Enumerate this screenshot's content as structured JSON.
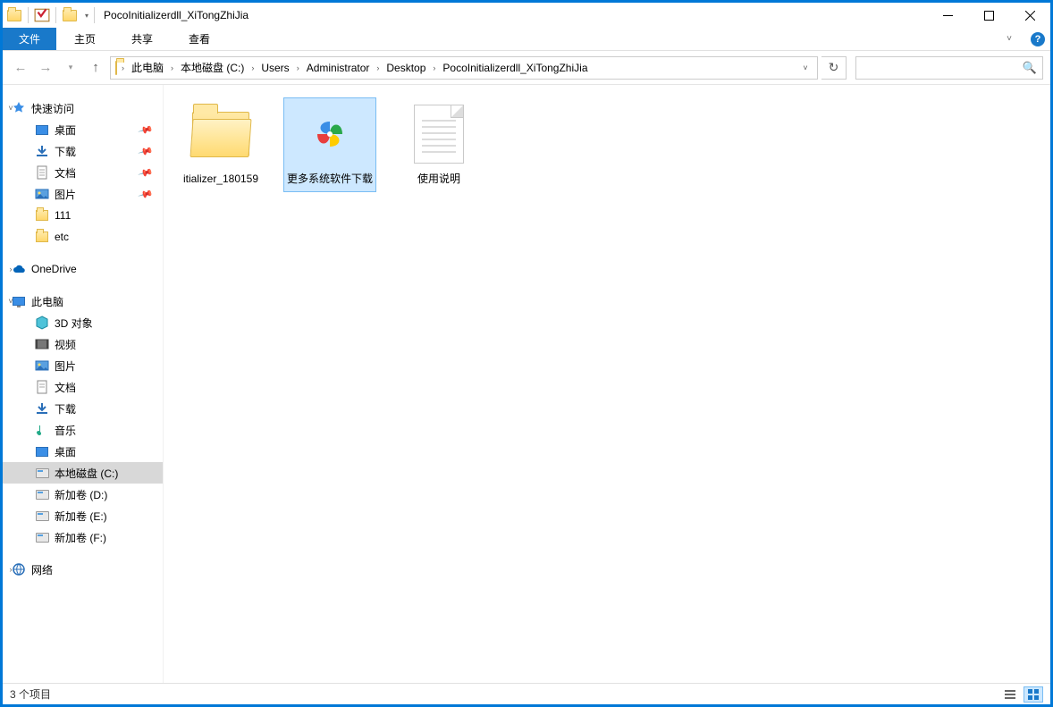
{
  "window": {
    "title": "PocoInitializerdll_XiTongZhiJia"
  },
  "ribbon": {
    "file": "文件",
    "tabs": [
      "主页",
      "共享",
      "查看"
    ]
  },
  "breadcrumb": {
    "items": [
      "此电脑",
      "本地磁盘 (C:)",
      "Users",
      "Administrator",
      "Desktop",
      "PocoInitializerdll_XiTongZhiJia"
    ]
  },
  "search": {
    "placeholder": ""
  },
  "tree": {
    "quick": {
      "label": "快速访问",
      "items": [
        {
          "label": "桌面",
          "pinned": true,
          "icon": "desktop"
        },
        {
          "label": "下载",
          "pinned": true,
          "icon": "download"
        },
        {
          "label": "文档",
          "pinned": true,
          "icon": "doc"
        },
        {
          "label": "图片",
          "pinned": true,
          "icon": "pic"
        },
        {
          "label": "111",
          "pinned": false,
          "icon": "folder"
        },
        {
          "label": "etc",
          "pinned": false,
          "icon": "folder"
        }
      ]
    },
    "onedrive": {
      "label": "OneDrive"
    },
    "pc": {
      "label": "此电脑",
      "items": [
        {
          "label": "3D 对象",
          "icon": "3d"
        },
        {
          "label": "视频",
          "icon": "video"
        },
        {
          "label": "图片",
          "icon": "pic"
        },
        {
          "label": "文档",
          "icon": "doc"
        },
        {
          "label": "下载",
          "icon": "download"
        },
        {
          "label": "音乐",
          "icon": "music"
        },
        {
          "label": "桌面",
          "icon": "desktop"
        },
        {
          "label": "本地磁盘 (C:)",
          "icon": "drive",
          "selected": true
        },
        {
          "label": "新加卷 (D:)",
          "icon": "drive"
        },
        {
          "label": "新加卷 (E:)",
          "icon": "drive"
        },
        {
          "label": "新加卷 (F:)",
          "icon": "drive"
        }
      ]
    },
    "network": {
      "label": "网络"
    }
  },
  "files": [
    {
      "name": "itializer_180159",
      "type": "folder",
      "selected": false
    },
    {
      "name": "更多系统软件下载",
      "type": "url",
      "selected": true
    },
    {
      "name": "使用说明",
      "type": "txt",
      "selected": false
    }
  ],
  "status": {
    "text": "3 个项目"
  }
}
